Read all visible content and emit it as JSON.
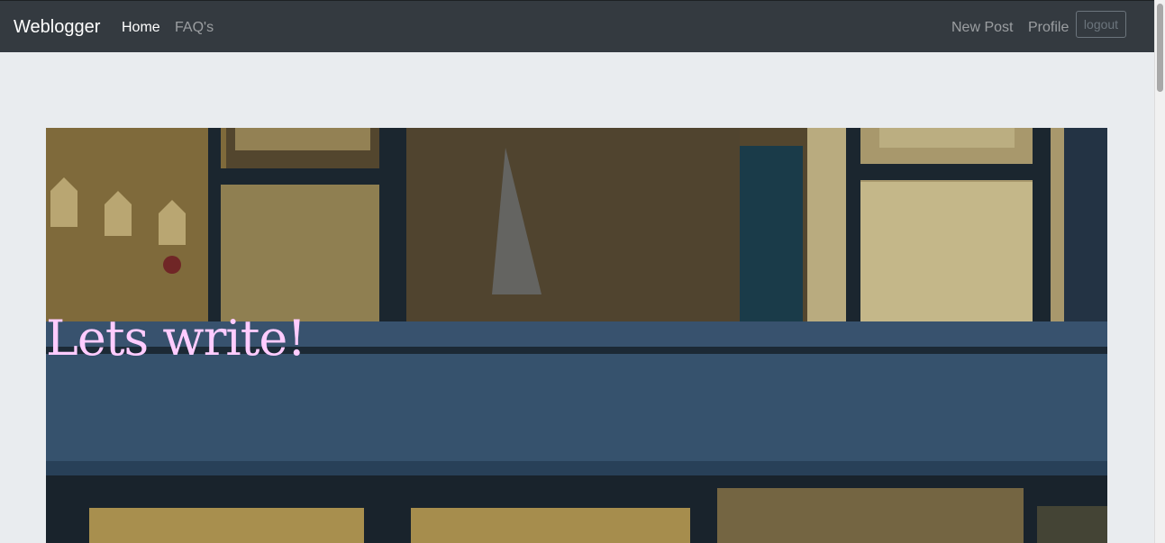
{
  "navbar": {
    "brand": "Weblogger",
    "left_links": [
      {
        "label": "Home",
        "active": true
      },
      {
        "label": "FAQ's",
        "active": false
      }
    ],
    "right_links": [
      {
        "label": "New Post"
      },
      {
        "label": "Profile"
      }
    ],
    "logout_label": "logout"
  },
  "hero": {
    "title": "Lets write!"
  },
  "colors": {
    "navbar_bg": "#343a40",
    "page_bg": "#e9ecef",
    "hero_title": "#ffccff"
  }
}
